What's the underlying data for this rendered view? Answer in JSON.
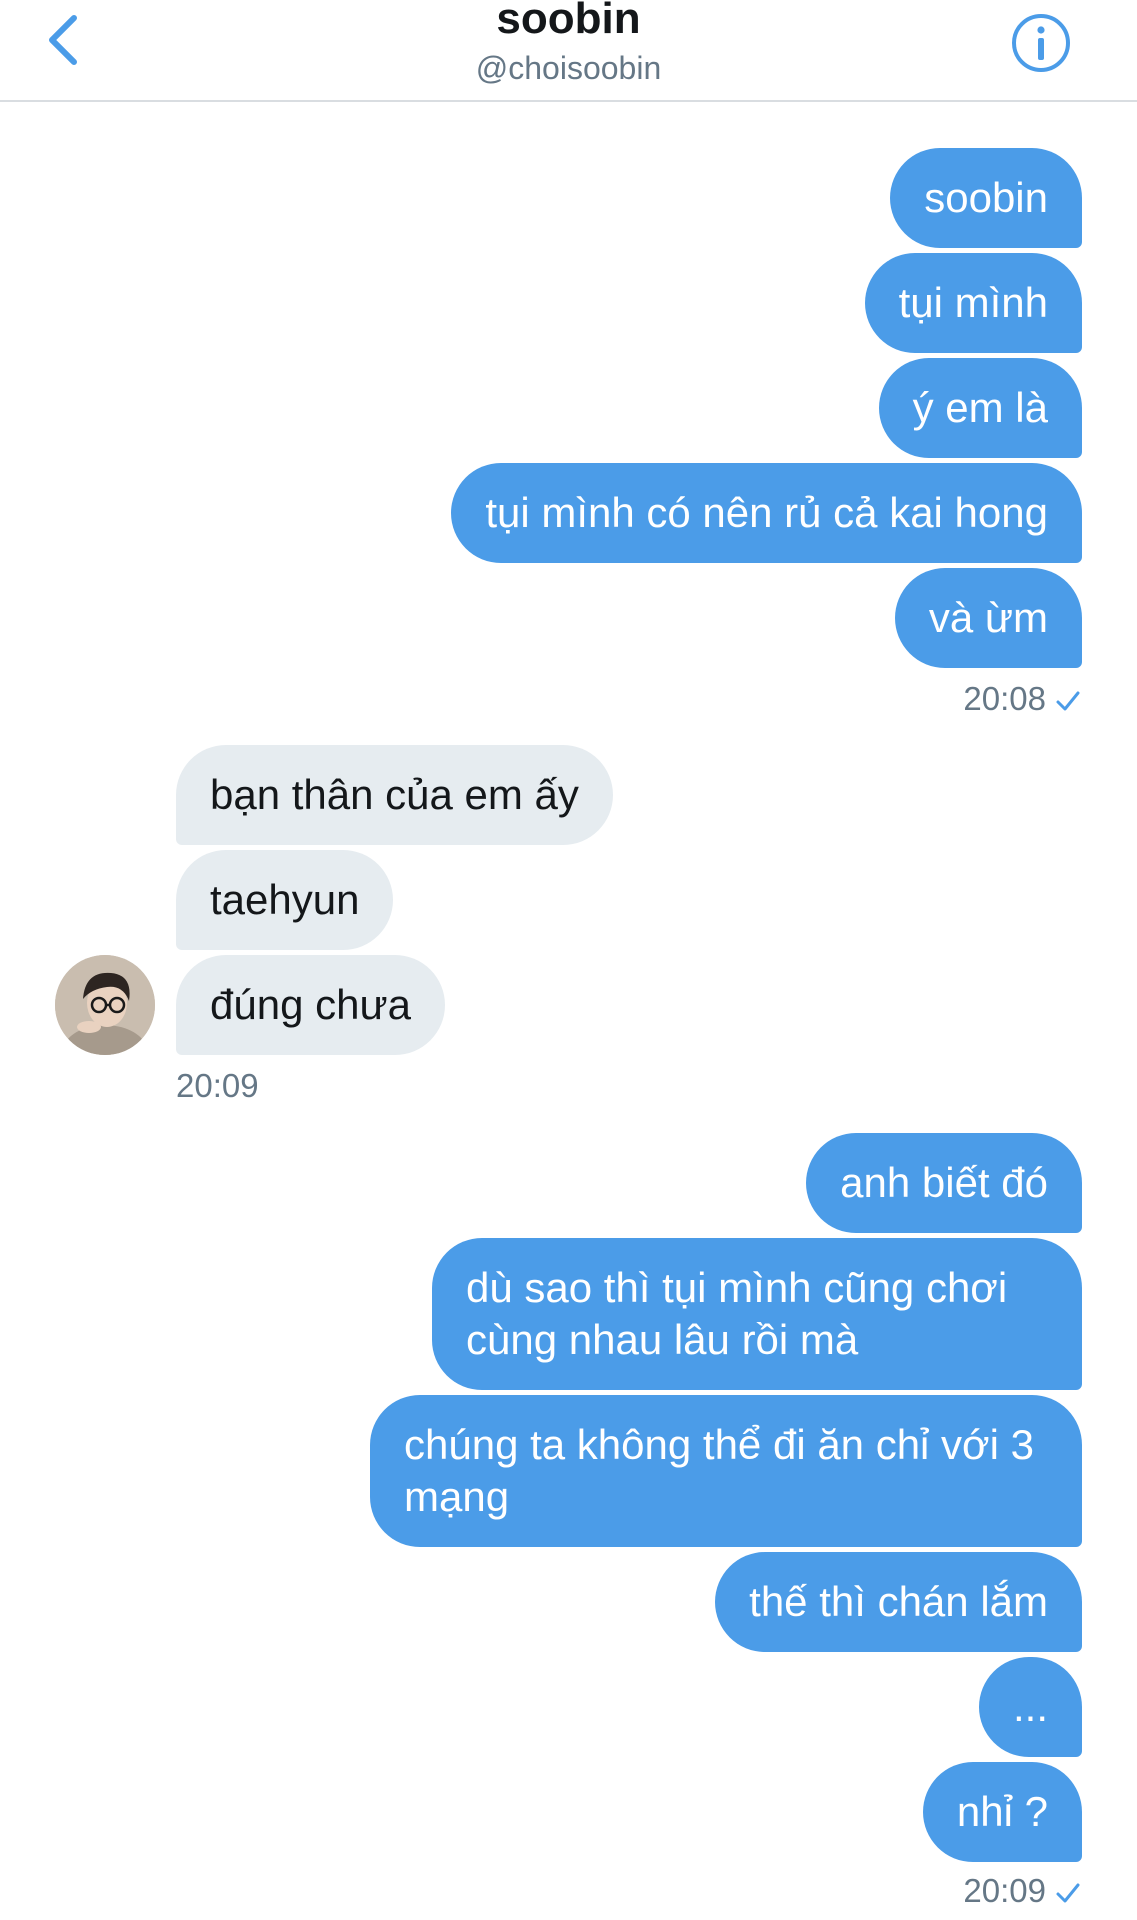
{
  "header": {
    "name": "soobin",
    "handle": "@choisoobin",
    "back_icon": "chevron-left-icon",
    "info_icon": "info-icon",
    "accent_color": "#4b9ce8"
  },
  "messages": {
    "group1": [
      "soobin",
      "tụi mình",
      "ý em là",
      "tụi mình có nên rủ cả kai hong",
      "và ừm"
    ],
    "group1_time": "20:08",
    "group2": [
      "bạn thân của em ấy",
      "taehyun",
      "đúng chưa"
    ],
    "group2_time": "20:09",
    "group3": [
      "anh biết đó",
      "dù sao thì tụi mình cũng chơi cùng nhau lâu rồi mà",
      "chúng ta không thể đi ăn chỉ với 3 mạng",
      "thế thì chán lắm",
      "...",
      "nhỉ ?"
    ],
    "group3_time": "20:09"
  },
  "colors": {
    "sent_bubble": "#4b9ce8",
    "received_bubble": "#e6ecf0",
    "timestamp": "#657786"
  }
}
